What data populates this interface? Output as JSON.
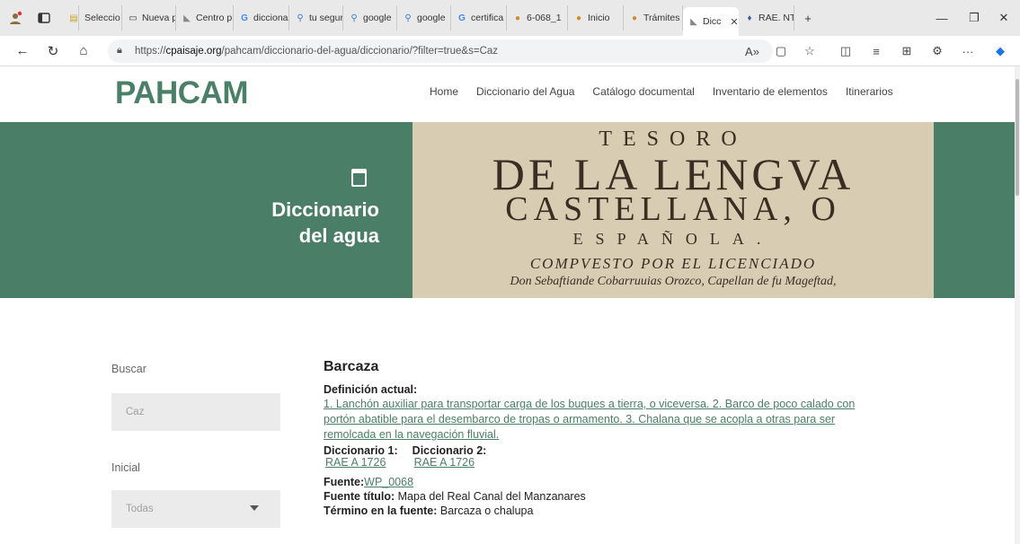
{
  "browser": {
    "tabs": [
      {
        "label": "",
        "icon": "profile-icon"
      },
      {
        "label": "",
        "icon": "tab-actions-icon"
      },
      {
        "label": "Seleccio",
        "icon": "folder-icon"
      },
      {
        "label": "Nueva p",
        "icon": "newtab-icon"
      },
      {
        "label": "Centro p",
        "icon": "site-icon"
      },
      {
        "label": "dicciona",
        "icon": "google-icon"
      },
      {
        "label": "tu segur",
        "icon": "search-icon"
      },
      {
        "label": "google",
        "icon": "search-icon"
      },
      {
        "label": "google",
        "icon": "search-icon"
      },
      {
        "label": "certifica",
        "icon": "google-icon"
      },
      {
        "label": "6-068_1",
        "icon": "site-icon"
      },
      {
        "label": "Inicio",
        "icon": "site-icon"
      },
      {
        "label": "Trámites",
        "icon": "site-icon"
      },
      {
        "label": "Dicc",
        "icon": "site-icon",
        "active": true
      },
      {
        "label": "RAE. NT",
        "icon": "site-icon"
      }
    ],
    "url_scheme": "https://",
    "url_host": "cpaisaje.org",
    "url_path": "/pahcam/diccionario-del-agua/diccionario/?filter=true&s=Caz"
  },
  "site": {
    "logo": "PAHCAM",
    "nav": [
      "Home",
      "Diccionario del Agua",
      "Catálogo documental",
      "Inventario de elementos",
      "Itinerarios"
    ]
  },
  "hero": {
    "title_line1": "Diccionario",
    "title_line2": "del agua",
    "book_lines": [
      "TESORO",
      "DE LA LENGVA",
      "CASTELLANA, O",
      "ESPAÑOLA.",
      "COMPVESTO POR EL LICENCIADO",
      "Don Sebaftiande Cobarruuias Orozco, Capellan de fu Mageftad,"
    ]
  },
  "filters": {
    "search_label": "Buscar",
    "search_value": "Caz",
    "initial_label": "Inicial",
    "initial_value": "Todas"
  },
  "entry": {
    "term": "Barcaza",
    "definition_label": "Definición actual:",
    "definition_line1": "1. Lanchón auxiliar para transportar carga de los buques a tierra, o viceversa. 2. Barco de poco calado con",
    "definition_line2": "portón abatible para el desembarco de tropas o armamento. 3. Chalana que se acopla a otras para ser",
    "definition_line3": "remolcada en la navegación fluvial.",
    "dict1_label": "Diccionario 1:",
    "dict1_value": "RAE A 1726",
    "dict2_label": "Diccionario 2:",
    "dict2_value": "RAE A 1726",
    "source_label": "Fuente:",
    "source_value": "WP_0068",
    "source_title_label": "Fuente título:",
    "source_title_value": "Mapa del Real Canal del Manzanares",
    "source_term_label": "Término en la fuente:",
    "source_term_value": "Barcaza o chalupa"
  },
  "colors": {
    "brand_green": "#4b7e67",
    "link_green": "#4b7e67"
  }
}
